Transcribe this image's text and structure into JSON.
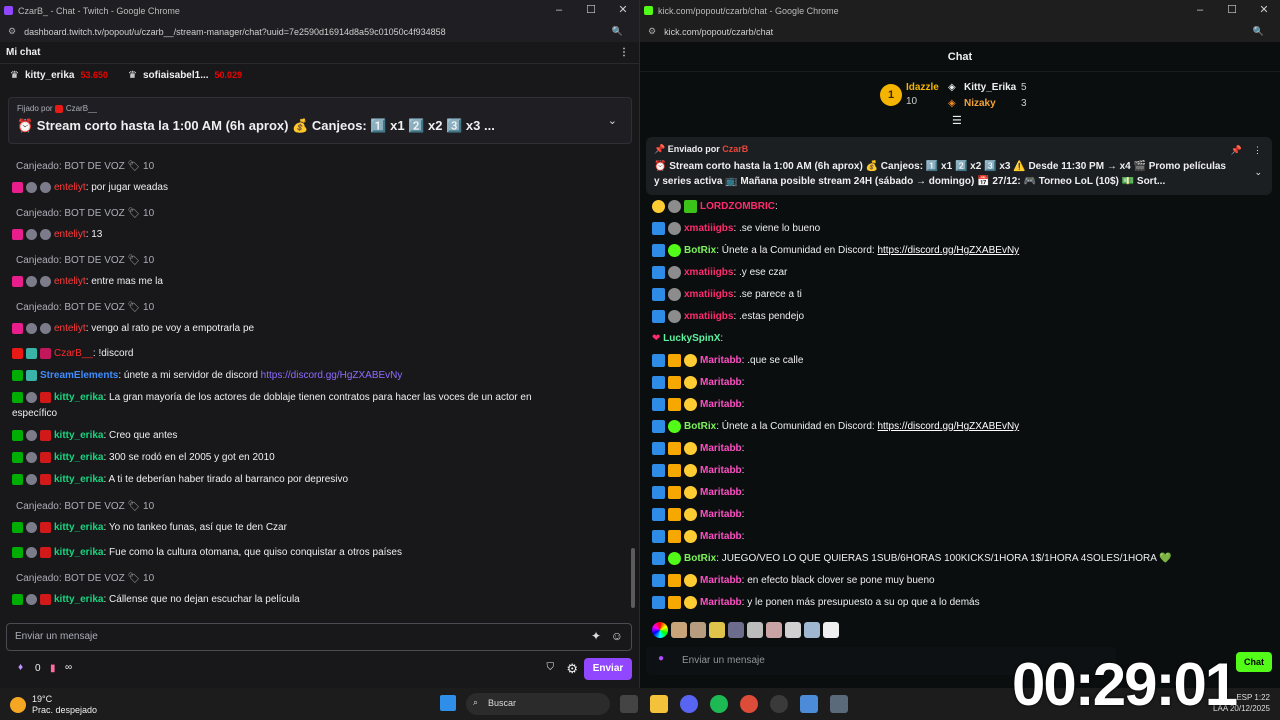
{
  "twitch_window": {
    "title": "CzarB_ - Chat - Twitch - Google Chrome",
    "url": "dashboard.twitch.tv/popout/u/czarb__/stream-manager/chat?uuid=7e2590d16914d8a59c01050c4f934858",
    "header": "Mi chat",
    "leaderboard": [
      {
        "name": "kitty_erika",
        "points": "53.650"
      },
      {
        "name": "sofiaisabel1...",
        "points": "50.029"
      }
    ],
    "pinned_by": "Fijado por",
    "pinned_user": "CzarB__",
    "pinned_message": "⏰ Stream corto hasta la 1:00 AM (6h aprox) 💰 Canjeos: 1️⃣ x1 2️⃣ x2 3️⃣ x3 ...",
    "messages": [
      {
        "type": "redeem",
        "text": "Canjeado: BOT DE VOZ 🏷 10"
      },
      {
        "type": "msg",
        "user": "enteliyt",
        "text": ": por jugar weadas"
      },
      {
        "type": "redeem",
        "text": "Canjeado: BOT DE VOZ 🏷 10"
      },
      {
        "type": "msg",
        "user": "enteliyt",
        "text": ": 13"
      },
      {
        "type": "redeem",
        "text": "Canjeado: BOT DE VOZ 🏷 10"
      },
      {
        "type": "msg",
        "user": "enteliyt",
        "text": ": entre mas me la"
      },
      {
        "type": "redeem",
        "text": "Canjeado: BOT DE VOZ 🏷 10"
      },
      {
        "type": "msg",
        "user": "enteliyt",
        "text": ": vengo al rato pe voy a empotrarla pe"
      },
      {
        "type": "msg",
        "user": "CzarB__",
        "text": ": !discord"
      },
      {
        "type": "msg",
        "user": "StreamElements",
        "text": ": únete a mi servidor de discord ",
        "link": "https://discord.gg/HgZXABEvNy"
      },
      {
        "type": "msg",
        "user": "kitty_erika",
        "text": ": La gran mayoría de los actores de doblaje tienen contratos para hacer las voces de un actor en",
        "cont": "específico"
      },
      {
        "type": "msg",
        "user": "kitty_erika",
        "text": ": Creo que antes"
      },
      {
        "type": "msg",
        "user": "kitty_erika",
        "text": ": 300 se rodó en el 2005 y got en 2010"
      },
      {
        "type": "msg",
        "user": "kitty_erika",
        "text": ": A ti te deberían haber tirado al barranco por depresivo"
      },
      {
        "type": "redeem",
        "text": "Canjeado: BOT DE VOZ 🏷 10"
      },
      {
        "type": "msg",
        "user": "kitty_erika",
        "text": ": Yo no tankeo funas, así que te den Czar"
      },
      {
        "type": "msg",
        "user": "kitty_erika",
        "text": ": Fue como la cultura otomana, que quiso conquistar a otros países"
      },
      {
        "type": "redeem",
        "text": "Canjeado: BOT DE VOZ 🏷 10"
      },
      {
        "type": "msg",
        "user": "kitty_erika",
        "text": ": Cállense que no dejan escuchar la película"
      }
    ],
    "input_placeholder": "Enviar un mensaje",
    "points_count": "0",
    "infinity": "∞",
    "send_label": "Enviar"
  },
  "kick_window": {
    "title": "kick.com/popout/czarb/chat - Google Chrome",
    "url": "kick.com/popout/czarb/chat",
    "header": "Chat",
    "leaderboard": {
      "first": {
        "rank": "1",
        "name": "Idazzle",
        "count": "10"
      },
      "second": {
        "name": "Kitty_Erika",
        "count": "5"
      },
      "third": {
        "name": "Nizaky",
        "count": "3"
      }
    },
    "pinned_label": "Enviado por",
    "pinned_user": "CzarB",
    "pinned_message": "⏰ Stream corto hasta la 1:00 AM (6h aprox) 💰 Canjeos: 1️⃣ x1 2️⃣ x2 3️⃣ x3 ⚠️ Desde 11:30 PM → x4 🎬 Promo películas y series activa 📺 Mañana posible stream 24H (sábado → domingo) 📅 27/12: 🎮 Torneo LoL (10$) 💵 Sort...",
    "messages": [
      {
        "user": "LORDZOMBRIC",
        "text": ":"
      },
      {
        "user": "xmatiiigbs",
        "text": ": .se viene lo bueno"
      },
      {
        "user": "BotRix",
        "text": ": Únete a la Comunidad en Discord: ",
        "link": "https://discord.gg/HgZXABEvNy"
      },
      {
        "user": "xmatiiigbs",
        "text": ": .y ese czar"
      },
      {
        "user": "xmatiiigbs",
        "text": ": .se parece a ti"
      },
      {
        "user": "xmatiiigbs",
        "text": ": .estas pendejo"
      },
      {
        "user": "LuckySpinX",
        "text": ":"
      },
      {
        "user": "Maritabb",
        "text": ": .que se calle"
      },
      {
        "user": "Maritabb",
        "text": ":"
      },
      {
        "user": "Maritabb",
        "text": ":"
      },
      {
        "user": "BotRix",
        "text": ": Únete a la Comunidad en Discord: ",
        "link": "https://discord.gg/HgZXABEvNy"
      },
      {
        "user": "Maritabb",
        "text": ":"
      },
      {
        "user": "Maritabb",
        "text": ":"
      },
      {
        "user": "Maritabb",
        "text": ":"
      },
      {
        "user": "Maritabb",
        "text": ":"
      },
      {
        "user": "Maritabb",
        "text": ":"
      },
      {
        "user": "BotRix",
        "text": ": JUEGO/VEO LO QUE QUIERAS 1SUB/6HORAS 100KICKS/1HORA 1$/1HORA 4SOLES/1HORA 💚"
      },
      {
        "user": "Maritabb",
        "text": ": en efecto black clover se pone muy bueno"
      },
      {
        "user": "Maritabb",
        "text": ": y le ponen más presupuesto a su op que a lo demás"
      }
    ],
    "input_placeholder": "Enviar un mensaje",
    "chat_button": "Chat"
  },
  "taskbar": {
    "temperature": "19°C",
    "weather": "Prac. despejado",
    "search_placeholder": "Buscar",
    "lang": "ESP",
    "region": "LAA",
    "time": "1:22",
    "date": "20/12/2025"
  },
  "overlay_timer": "00:29:01",
  "colors": {
    "twitch_accent": "#9147ff",
    "kick_accent": "#53fc18"
  }
}
